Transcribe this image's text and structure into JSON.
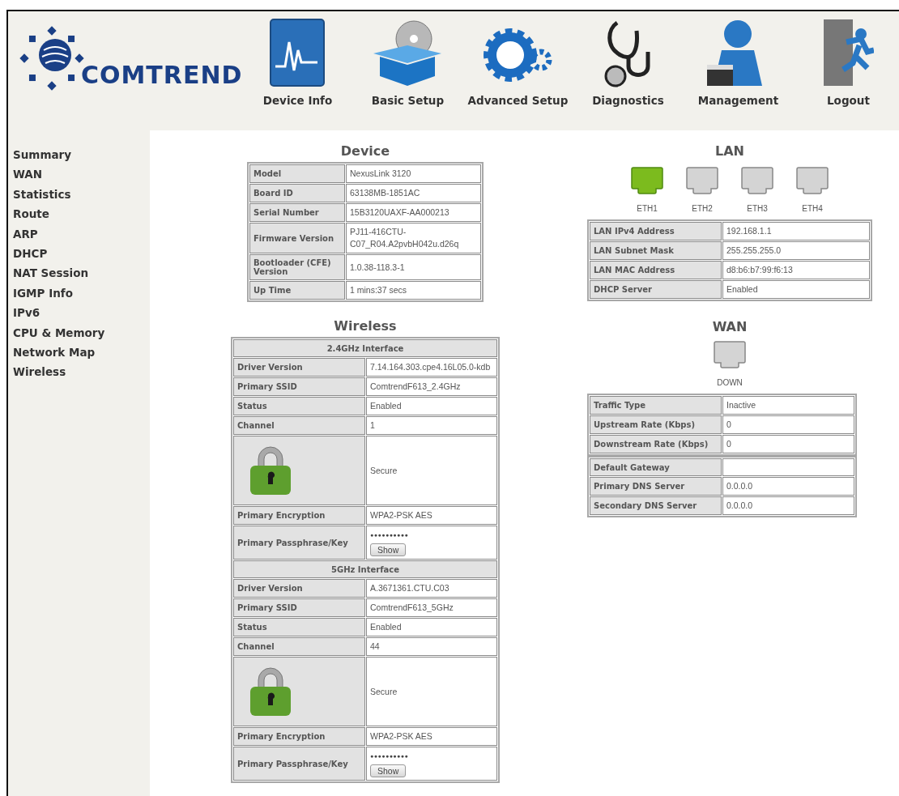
{
  "logo": {
    "text": "COMTREND"
  },
  "nav": [
    {
      "label": "Device Info"
    },
    {
      "label": "Basic Setup"
    },
    {
      "label": "Advanced Setup"
    },
    {
      "label": "Diagnostics"
    },
    {
      "label": "Management"
    },
    {
      "label": "Logout"
    }
  ],
  "sidebar": {
    "items": [
      "Summary",
      "WAN",
      "Statistics",
      "Route",
      "ARP",
      "DHCP",
      "NAT Session",
      "IGMP Info",
      "IPv6",
      "CPU & Memory",
      "Network Map",
      "Wireless"
    ]
  },
  "device": {
    "title": "Device",
    "rows": [
      {
        "label": "Model",
        "value": "NexusLink 3120"
      },
      {
        "label": "Board ID",
        "value": "63138MB-1851AC"
      },
      {
        "label": "Serial Number",
        "value": "15B3120UAXF-AA000213"
      },
      {
        "label": "Firmware Version",
        "value": "PJ11-416CTU-C07_R04.A2pvbH042u.d26q"
      },
      {
        "label": "Bootloader (CFE) Version",
        "value": "1.0.38-118.3-1"
      },
      {
        "label": "Up Time",
        "value": "1 mins:37 secs"
      }
    ]
  },
  "wireless": {
    "title": "Wireless",
    "interfaces": [
      {
        "title": "2.4GHz Interface",
        "rows": [
          {
            "kind": "text",
            "label": "Driver Version",
            "value": "7.14.164.303.cpe4.16L05.0-kdb"
          },
          {
            "kind": "text",
            "label": "Primary SSID",
            "value": "ComtrendF613_2.4GHz"
          },
          {
            "kind": "text",
            "label": "Status",
            "value": "Enabled"
          },
          {
            "kind": "text",
            "label": "Channel",
            "value": "1"
          },
          {
            "kind": "lock",
            "value": "Secure"
          },
          {
            "kind": "text",
            "label": "Primary Encryption",
            "value": "WPA2-PSK AES"
          },
          {
            "kind": "passphrase",
            "label": "Primary Passphrase/Key",
            "value": "●●●●●●●●●●",
            "button": "Show"
          }
        ]
      },
      {
        "title": "5GHz Interface",
        "rows": [
          {
            "kind": "text",
            "label": "Driver Version",
            "value": "A.3671361.CTU.C03"
          },
          {
            "kind": "text",
            "label": "Primary SSID",
            "value": "ComtrendF613_5GHz"
          },
          {
            "kind": "text",
            "label": "Status",
            "value": "Enabled"
          },
          {
            "kind": "text",
            "label": "Channel",
            "value": "44"
          },
          {
            "kind": "lock",
            "value": "Secure"
          },
          {
            "kind": "text",
            "label": "Primary Encryption",
            "value": "WPA2-PSK AES"
          },
          {
            "kind": "passphrase",
            "label": "Primary Passphrase/Key",
            "value": "●●●●●●●●●●",
            "button": "Show"
          }
        ]
      }
    ]
  },
  "lan": {
    "title": "LAN",
    "ports": [
      {
        "label": "ETH1",
        "up": true
      },
      {
        "label": "ETH2",
        "up": false
      },
      {
        "label": "ETH3",
        "up": false
      },
      {
        "label": "ETH4",
        "up": false
      }
    ],
    "rows": [
      {
        "label": "LAN IPv4 Address",
        "value": "192.168.1.1"
      },
      {
        "label": "LAN Subnet Mask",
        "value": "255.255.255.0"
      },
      {
        "label": "LAN MAC Address",
        "value": "d8:b6:b7:99:f6:13"
      },
      {
        "label": "DHCP Server",
        "value": "Enabled"
      }
    ]
  },
  "wan": {
    "title": "WAN",
    "port": {
      "label": "DOWN",
      "up": false
    },
    "groups": [
      [
        {
          "label": "Traffic Type",
          "value": "Inactive"
        },
        {
          "label": "Upstream Rate (Kbps)",
          "value": "0"
        },
        {
          "label": "Downstream Rate (Kbps)",
          "value": "0"
        }
      ],
      [
        {
          "label": "Default Gateway"
        },
        {
          "label": "Primary DNS Server",
          "value": "0.0.0.0"
        },
        {
          "label": "Secondary DNS Server",
          "value": "0.0.0.0"
        }
      ]
    ]
  }
}
